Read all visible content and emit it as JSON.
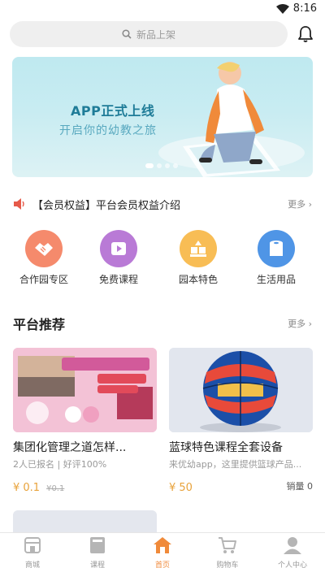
{
  "status_bar": {
    "time": "8:16"
  },
  "search": {
    "placeholder": "新品上架"
  },
  "banner": {
    "headline": "APP正式上线",
    "subline": "开启你的幼教之旅",
    "active_dot": 0,
    "dot_count": 4
  },
  "notice": {
    "text": "【会员权益】平台会员权益介绍",
    "more": "更多"
  },
  "categories": [
    {
      "label": "合作园专区",
      "icon": "handshake-icon",
      "color": "#f07a5a"
    },
    {
      "label": "免费课程",
      "icon": "play-icon",
      "color": "#b46fd1"
    },
    {
      "label": "园本特色",
      "icon": "blocks-icon",
      "color": "#f5b34a"
    },
    {
      "label": "生活用品",
      "icon": "tissue-icon",
      "color": "#4a90e2"
    }
  ],
  "section": {
    "title": "平台推荐",
    "more": "更多"
  },
  "products": [
    {
      "title": "集团化管理之道怎样...",
      "meta": "2人已报名 | 好评100%",
      "price": "¥ 0.1",
      "original_price": "¥0.1",
      "sales": ""
    },
    {
      "title": "蓝球特色课程全套设备",
      "meta": "来优幼app，这里提供篮球产品...",
      "price": "¥ 50",
      "original_price": "",
      "sales": "销量 0"
    }
  ],
  "tabs": [
    {
      "label": "商城",
      "icon": "shop-icon"
    },
    {
      "label": "课程",
      "icon": "book-icon"
    },
    {
      "label": "首页",
      "icon": "home-icon",
      "active": true
    },
    {
      "label": "购物车",
      "icon": "cart-icon"
    },
    {
      "label": "个人中心",
      "icon": "person-icon"
    }
  ],
  "colors": {
    "accent": "#f08a3a",
    "price": "#e8a23a",
    "banner_text": "#1f7c98"
  }
}
